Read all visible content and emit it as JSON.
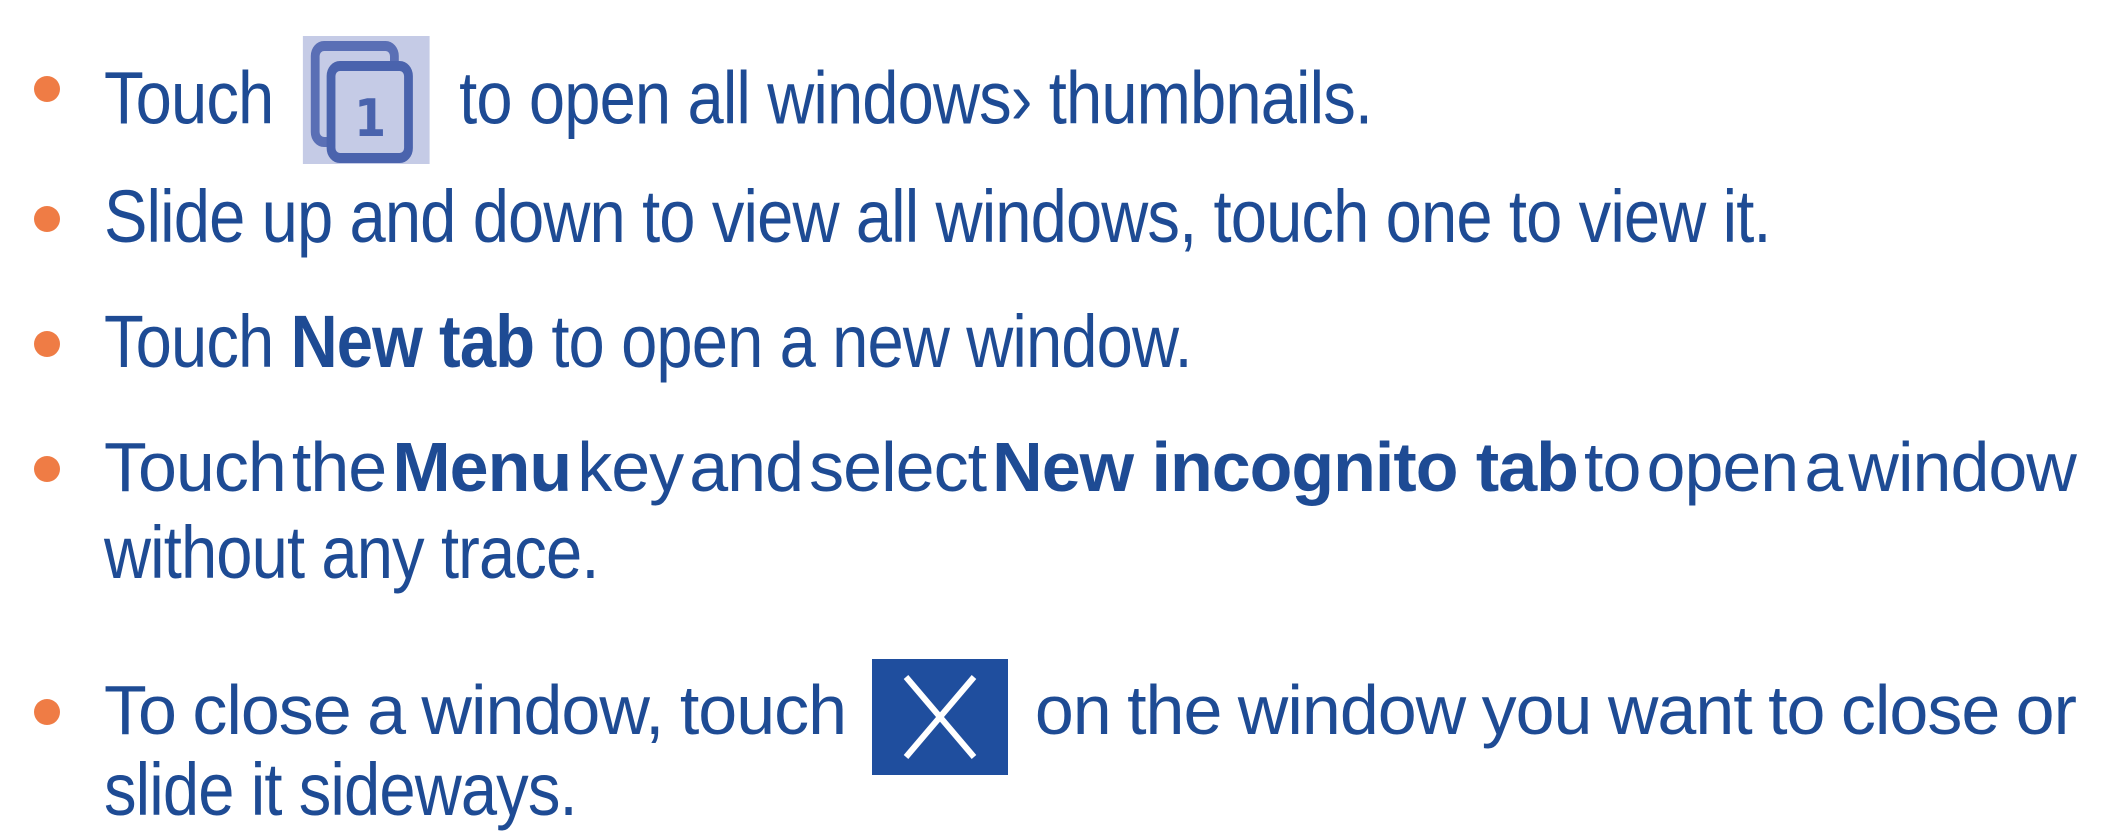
{
  "items": [
    {
      "pre": "Touch",
      "icon": "windows-thumbnails-icon",
      "post": "to open all windows› thumbnails."
    },
    {
      "text": "Slide up and down to view all windows, touch one to view it."
    },
    {
      "pre": "Touch",
      "bold": "New tab",
      "post": "to open a new window."
    },
    {
      "words": [
        "Touch",
        "the"
      ],
      "bold1": "Menu",
      "words2": [
        "key",
        "and",
        "select"
      ],
      "bold2": "New incognito tab",
      "words3": [
        "to",
        "open",
        "a",
        "window"
      ],
      "line2": "without any trace."
    },
    {
      "words": [
        "To",
        "close",
        "a",
        "window,",
        "touch"
      ],
      "icon": "close-x-icon",
      "words2": [
        "on",
        "the",
        "window",
        "you",
        "want",
        "to",
        "close",
        "or"
      ],
      "line2": "slide it sideways."
    }
  ],
  "colors": {
    "text": "#1e4b94",
    "bullet": "#ef7c45",
    "icon_bg_light": "#c5cbe6",
    "icon_bg_dark": "#1f4e9e"
  },
  "icon_glyphs": {
    "windows_number": "1"
  }
}
